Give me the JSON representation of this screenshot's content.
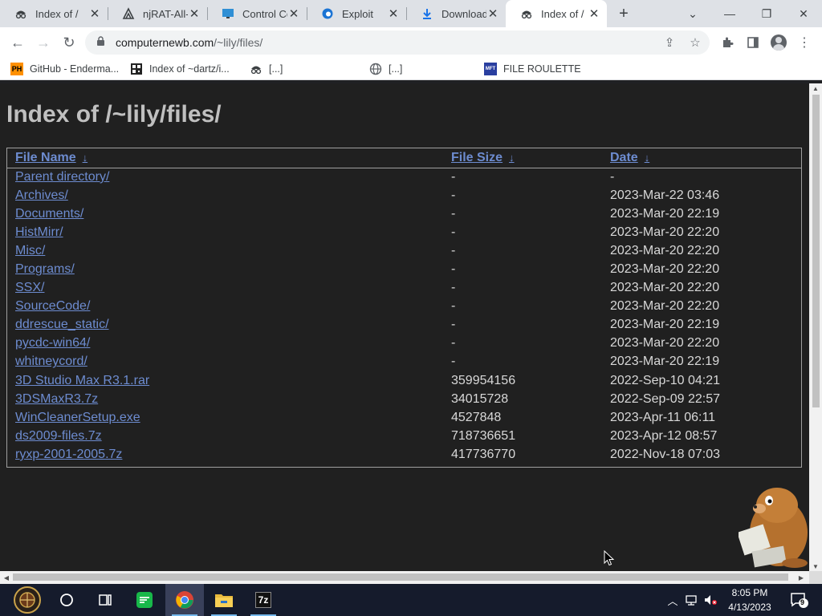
{
  "browser": {
    "tabs": [
      {
        "label": "Index of /",
        "icon": "spy-icon",
        "active": false
      },
      {
        "label": "njRAT-All-",
        "icon": "github-like-icon",
        "active": false
      },
      {
        "label": "Control Co",
        "icon": "monitor-icon",
        "active": false
      },
      {
        "label": "Exploit",
        "icon": "edge-like-icon",
        "active": false
      },
      {
        "label": "Downloads",
        "icon": "download-icon",
        "active": false
      },
      {
        "label": "Index of /",
        "icon": "spy-icon",
        "active": true
      }
    ],
    "address": {
      "host": "computernewb.com",
      "path": "/~lily/files/"
    },
    "bookmarks": [
      {
        "label": "GitHub - Enderma...",
        "icon": "ph-icon",
        "icon_text": "PH"
      },
      {
        "label": "Index of ~dartz/i...",
        "icon": "qr-icon",
        "icon_text": ""
      },
      {
        "label": "[...]",
        "icon": "spy-icon",
        "icon_text": ""
      },
      {
        "label": "[...]",
        "icon": "globe-icon",
        "icon_text": ""
      },
      {
        "label": "FILE ROULETTE",
        "icon": "mft-icon",
        "icon_text": "MFT"
      }
    ]
  },
  "page": {
    "title": "Index of /~lily/files/",
    "columns": {
      "name": "File Name",
      "size": "File Size",
      "date": "Date",
      "sort_glyph": "↓"
    },
    "rows": [
      {
        "name": "Parent directory/",
        "size": "-",
        "date": "-"
      },
      {
        "name": "Archives/",
        "size": "-",
        "date": "2023-Mar-22 03:46"
      },
      {
        "name": "Documents/",
        "size": "-",
        "date": "2023-Mar-20 22:19"
      },
      {
        "name": "HistMirr/",
        "size": "-",
        "date": "2023-Mar-20 22:20"
      },
      {
        "name": "Misc/",
        "size": "-",
        "date": "2023-Mar-20 22:20"
      },
      {
        "name": "Programs/",
        "size": "-",
        "date": "2023-Mar-20 22:20"
      },
      {
        "name": "SSX/",
        "size": "-",
        "date": "2023-Mar-20 22:20"
      },
      {
        "name": "SourceCode/",
        "size": "-",
        "date": "2023-Mar-20 22:20"
      },
      {
        "name": "ddrescue_static/",
        "size": "-",
        "date": "2023-Mar-20 22:19"
      },
      {
        "name": "pycdc-win64/",
        "size": "-",
        "date": "2023-Mar-20 22:20"
      },
      {
        "name": "whitneycord/",
        "size": "-",
        "date": "2023-Mar-20 22:19"
      },
      {
        "name": "3D Studio Max R3.1.rar",
        "size": "359954156",
        "date": "2022-Sep-10 04:21"
      },
      {
        "name": "3DSMaxR3.7z",
        "size": "34015728",
        "date": "2022-Sep-09 22:57"
      },
      {
        "name": "WinCleanerSetup.exe",
        "size": "4527848",
        "date": "2023-Apr-11 06:11"
      },
      {
        "name": "ds2009-files.7z",
        "size": "718736651",
        "date": "2023-Apr-12 08:57"
      },
      {
        "name": "ryxp-2001-2005.7z",
        "size": "417736770",
        "date": "2022-Nov-18 07:03"
      }
    ]
  },
  "taskbar": {
    "apps": [
      "start-orb",
      "cortana",
      "task-view",
      "gamepad-app",
      "chrome",
      "file-explorer",
      "7zip"
    ],
    "app_7zip_label": "7z",
    "clock_time": "8:05 PM",
    "clock_date": "4/13/2023",
    "notification_count": "9"
  },
  "colors": {
    "page_bg": "#202020",
    "link": "#6d8cd0",
    "title": "#c0c0c0",
    "text": "#d8d8d8",
    "taskbar": "#151b2c"
  }
}
